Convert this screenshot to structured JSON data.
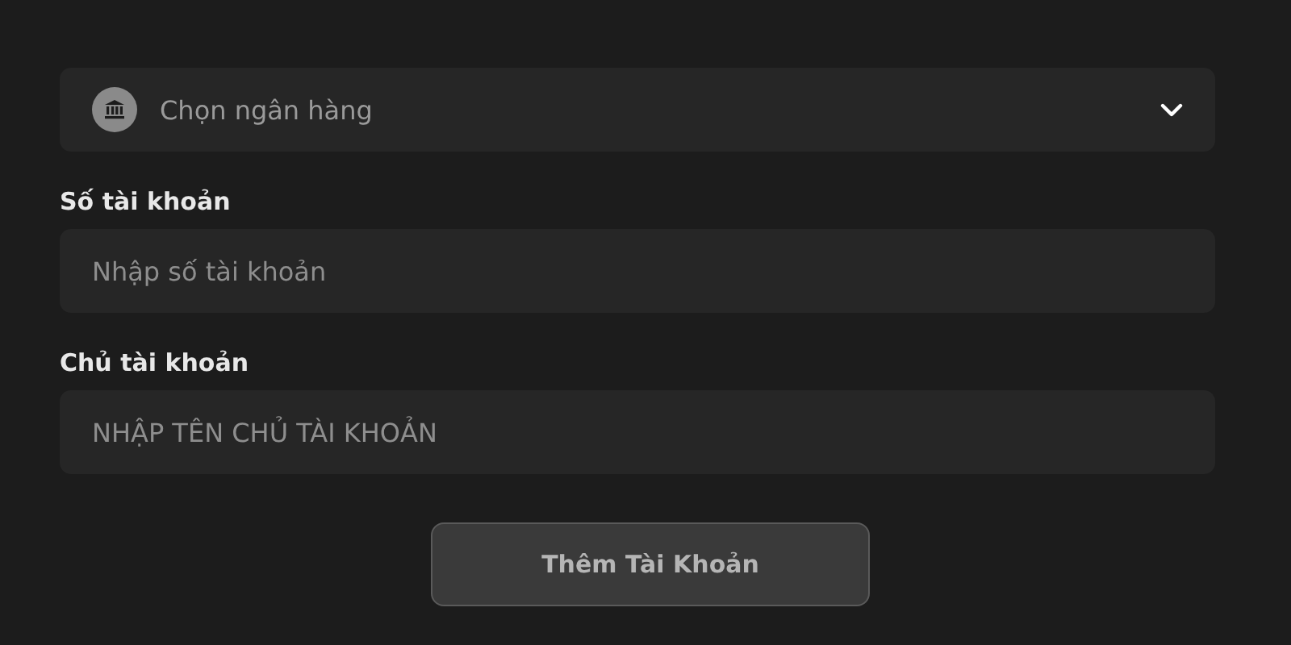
{
  "bank_select": {
    "placeholder": "Chọn ngân hàng"
  },
  "fields": [
    {
      "label": "Số tài khoản",
      "placeholder": "Nhập số tài khoản"
    },
    {
      "label": "Chủ tài khoản",
      "placeholder": "NHẬP TÊN CHỦ TÀI KHOẢN"
    }
  ],
  "submit_button": {
    "label": "Thêm Tài Khoản"
  }
}
